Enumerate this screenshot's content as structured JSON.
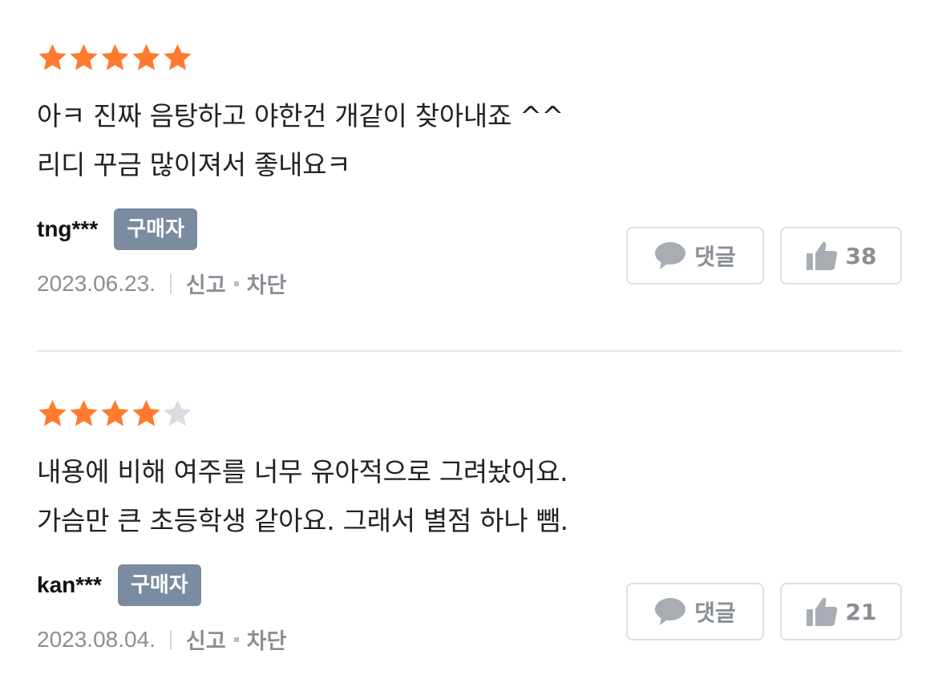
{
  "colors": {
    "star_filled": "#ff7a2f",
    "star_empty": "#d9dce0",
    "badge_bg": "#7b8ba0",
    "meta_text": "#8a8f96"
  },
  "reviews": [
    {
      "rating": 5,
      "lines": [
        "아ㅋ 진짜 음탕하고 야한건 개같이 찾아내죠 ^^",
        "리디 꾸금 많이져서 좋내요ㅋ"
      ],
      "username": "tng***",
      "badge": "구매자",
      "date": "2023.06.23.",
      "report": "신고",
      "block": "차단",
      "comment_label": "댓글",
      "likes": "38"
    },
    {
      "rating": 4,
      "lines": [
        "내용에 비해 여주를 너무 유아적으로 그려놨어요.",
        "가슴만 큰 초등학생 같아요. 그래서 별점 하나 뺌."
      ],
      "username": "kan***",
      "badge": "구매자",
      "date": "2023.08.04.",
      "report": "신고",
      "block": "차단",
      "comment_label": "댓글",
      "likes": "21"
    }
  ]
}
